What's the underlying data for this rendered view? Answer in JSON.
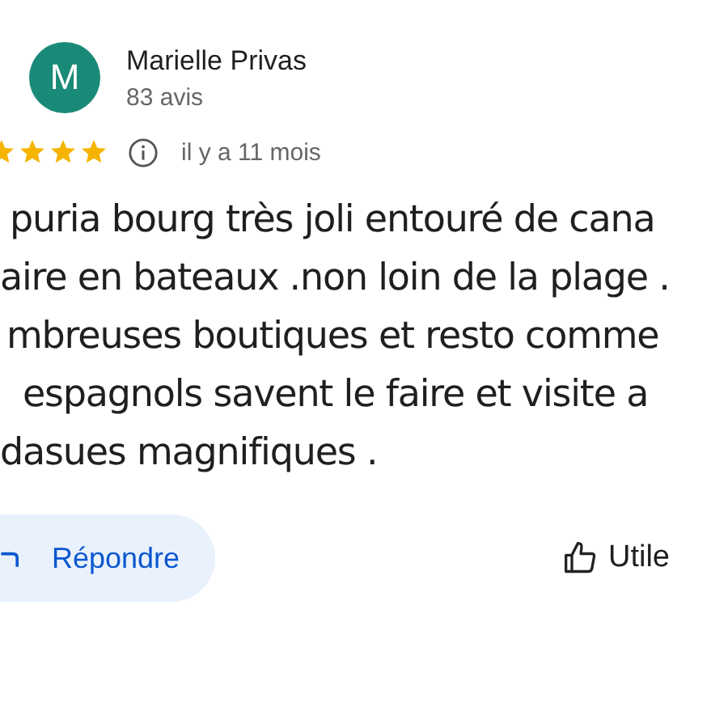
{
  "reviewer": {
    "initial": "M",
    "name": "Marielle Privas",
    "reviews": "83 avis"
  },
  "rating": {
    "stars": 4,
    "time": "il y a 11 mois"
  },
  "review_lines": [
    "puria bourg très joli entouré de cana",
    "aire en bateaux .non loin de la plage .",
    "mbreuses boutiques et resto comme",
    "espagnols savent le faire et visite a",
    "dasues magnifiques ."
  ],
  "actions": {
    "reply": "Répondre",
    "helpful": "Utile"
  }
}
